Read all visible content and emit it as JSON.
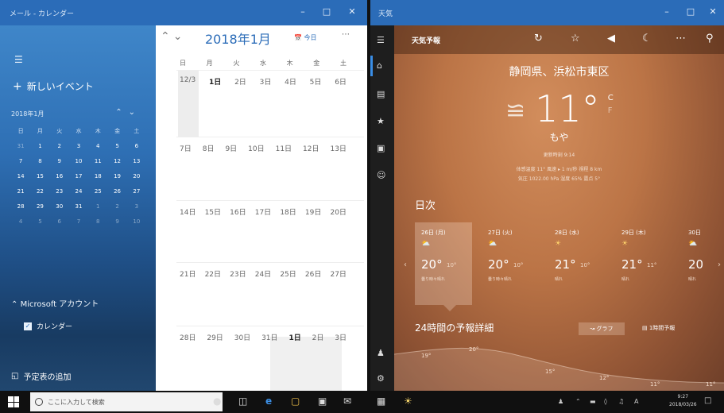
{
  "calendar": {
    "window_title": "メール - カレンダー",
    "new_event": "新しいイベント",
    "mini_month": "2018年1月",
    "mini_dow": [
      "日",
      "月",
      "火",
      "水",
      "木",
      "金",
      "土"
    ],
    "mini_days": [
      [
        "31",
        "1",
        "2",
        "3",
        "4",
        "5",
        "6"
      ],
      [
        "7",
        "8",
        "9",
        "10",
        "11",
        "12",
        "13"
      ],
      [
        "14",
        "15",
        "16",
        "17",
        "18",
        "19",
        "20"
      ],
      [
        "21",
        "22",
        "23",
        "24",
        "25",
        "26",
        "27"
      ],
      [
        "28",
        "29",
        "30",
        "31",
        "1",
        "2",
        "3"
      ],
      [
        "4",
        "5",
        "6",
        "7",
        "8",
        "9",
        "10"
      ]
    ],
    "account": "Microsoft アカウント",
    "calendar_item": "カレンダー",
    "add_calendar": "予定表の追加",
    "month_title": "2018年1月",
    "today": "今日",
    "dow": [
      "日",
      "月",
      "火",
      "水",
      "木",
      "金",
      "土"
    ],
    "weeks": [
      [
        "12/3",
        "1日",
        "2日",
        "3日",
        "4日",
        "5日",
        "6日"
      ],
      [
        "7日",
        "8日",
        "9日",
        "10日",
        "11日",
        "12日",
        "13日"
      ],
      [
        "14日",
        "15日",
        "16日",
        "17日",
        "18日",
        "19日",
        "20日"
      ],
      [
        "21日",
        "22日",
        "23日",
        "24日",
        "25日",
        "26日",
        "27日"
      ],
      [
        "28日",
        "29日",
        "30日",
        "31日",
        "1日",
        "2日",
        "3日"
      ]
    ]
  },
  "weather": {
    "window_title": "天気",
    "app_name": "天気予報",
    "location": "静岡県、浜松市東区",
    "temp": "11°",
    "unit_c": "C",
    "unit_f": "F",
    "condition": "もや",
    "updated": "更新時刻 9:14",
    "details_1": "体感温度 11°   風速 ▸ 1 m/秒   視程 8 km",
    "details_2": "気圧 1022.00 hPa   湿度 65%   露点 5°",
    "daily_heading": "日次",
    "days": [
      {
        "name": "26日 (月)",
        "hi": "20°",
        "lo": "10°",
        "summary": "曇り時々晴れ"
      },
      {
        "name": "27日 (火)",
        "hi": "20°",
        "lo": "10°",
        "summary": "曇り時々晴れ"
      },
      {
        "name": "28日 (水)",
        "hi": "21°",
        "lo": "10°",
        "summary": "晴れ"
      },
      {
        "name": "29日 (木)",
        "hi": "21°",
        "lo": "11°",
        "summary": "晴れ"
      },
      {
        "name": "30日",
        "hi": "20",
        "lo": "",
        "summary": "晴れ"
      }
    ],
    "hourly_heading": "24時間の予報詳細",
    "graph_btn": "グラフ",
    "hourly_btn": "1時間予報",
    "hourly_temps": [
      "19°",
      "20°",
      "15°",
      "12°",
      "11°",
      "11°"
    ]
  },
  "taskbar": {
    "search_placeholder": "ここに入力して検索",
    "ime": "A",
    "time": "9:27",
    "date": "2018/03/26"
  }
}
